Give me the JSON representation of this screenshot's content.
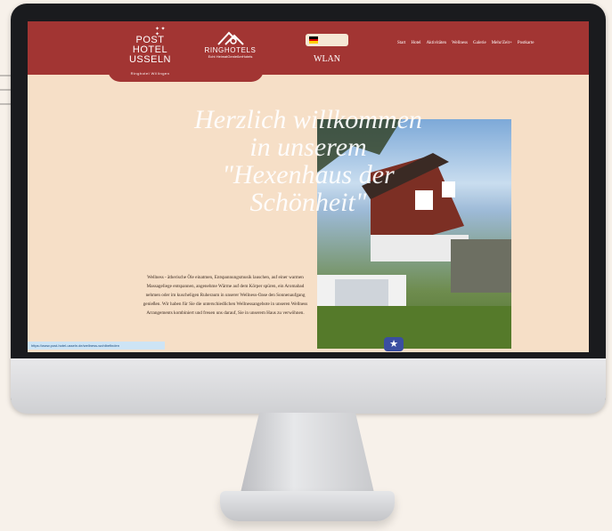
{
  "header": {
    "logo_post": {
      "line1": "POST",
      "line2": "HOTEL",
      "line3": "USSELN",
      "subtitle": "Ringhotel Willingen"
    },
    "ringhotels": {
      "name": "RINGHOTELS",
      "tagline": "Echt HeimatGenießerHotels"
    },
    "language_flag": "de-flag-icon",
    "wlan_label": "WLAN",
    "nav": [
      "Start",
      "Hotel",
      "Aktivitäten",
      "Wellness",
      "Galerie",
      "Mehr/Zeit+",
      "Postkarte"
    ]
  },
  "hero": {
    "title": "Herzlich willkommen in unserem \"Hexenhaus der Schönheit\""
  },
  "body": {
    "text": "Wellness - ätherische Öle einatmen, Entspannungsmusik lauschen, auf einer warmen Massageliege entspannen, angenehme Wärme auf dem Körper spüren, ein Aromabad nehmen oder im kuscheligen Ruheraum in unserer Wellness-Oase den Sonnenaufgang genießen. Wir haben für Sie die unterschiedlichen Wellnessangebote in unseren Wellness Arrangements kombiniert und freuen uns darauf, Sie in unserem Haus zu verwöhnen."
  },
  "status_bar": {
    "url": "https://www.post-hotel-usseln.de/wellness-wohlbefinden"
  },
  "colors": {
    "header_red": "#a23533",
    "page_bg": "#f6dfc7",
    "accent_badge": "#3a4ea1"
  }
}
